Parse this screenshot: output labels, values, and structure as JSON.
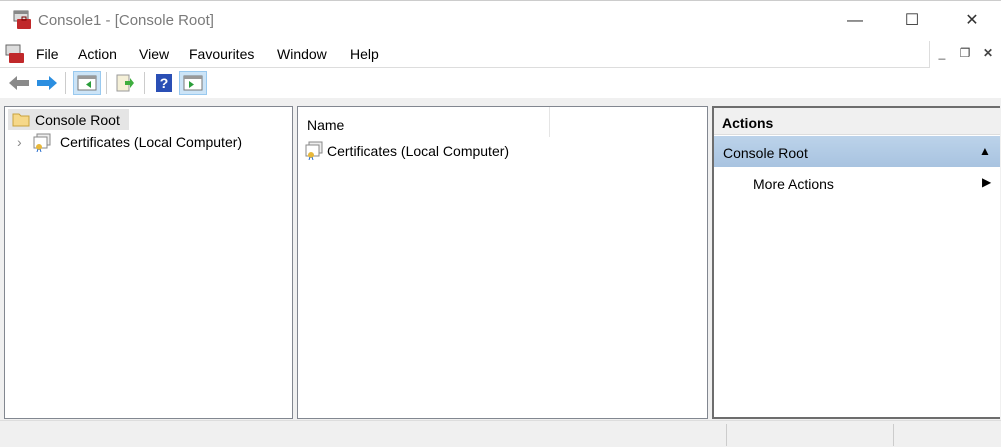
{
  "window": {
    "title": "Console1 - [Console Root]",
    "minimize": "—",
    "maximize": "☐",
    "close": "✕"
  },
  "menu": [
    "File",
    "Action",
    "View",
    "Favourites",
    "Window",
    "Help"
  ],
  "mdi": {
    "minimize": "_",
    "restore": "❐",
    "close": "✕"
  },
  "tree": {
    "root": "Console Root",
    "child": "Certificates (Local Computer)",
    "expander": "›"
  },
  "list": {
    "column": "Name",
    "items": [
      "Certificates (Local Computer)"
    ]
  },
  "actions": {
    "header": "Actions",
    "section": "Console Root",
    "section_arrow": "▲",
    "item": "More Actions",
    "item_arrow": "▶"
  },
  "colors": {
    "accent": "#b8d0e8",
    "selection": "#e5e5e5"
  }
}
